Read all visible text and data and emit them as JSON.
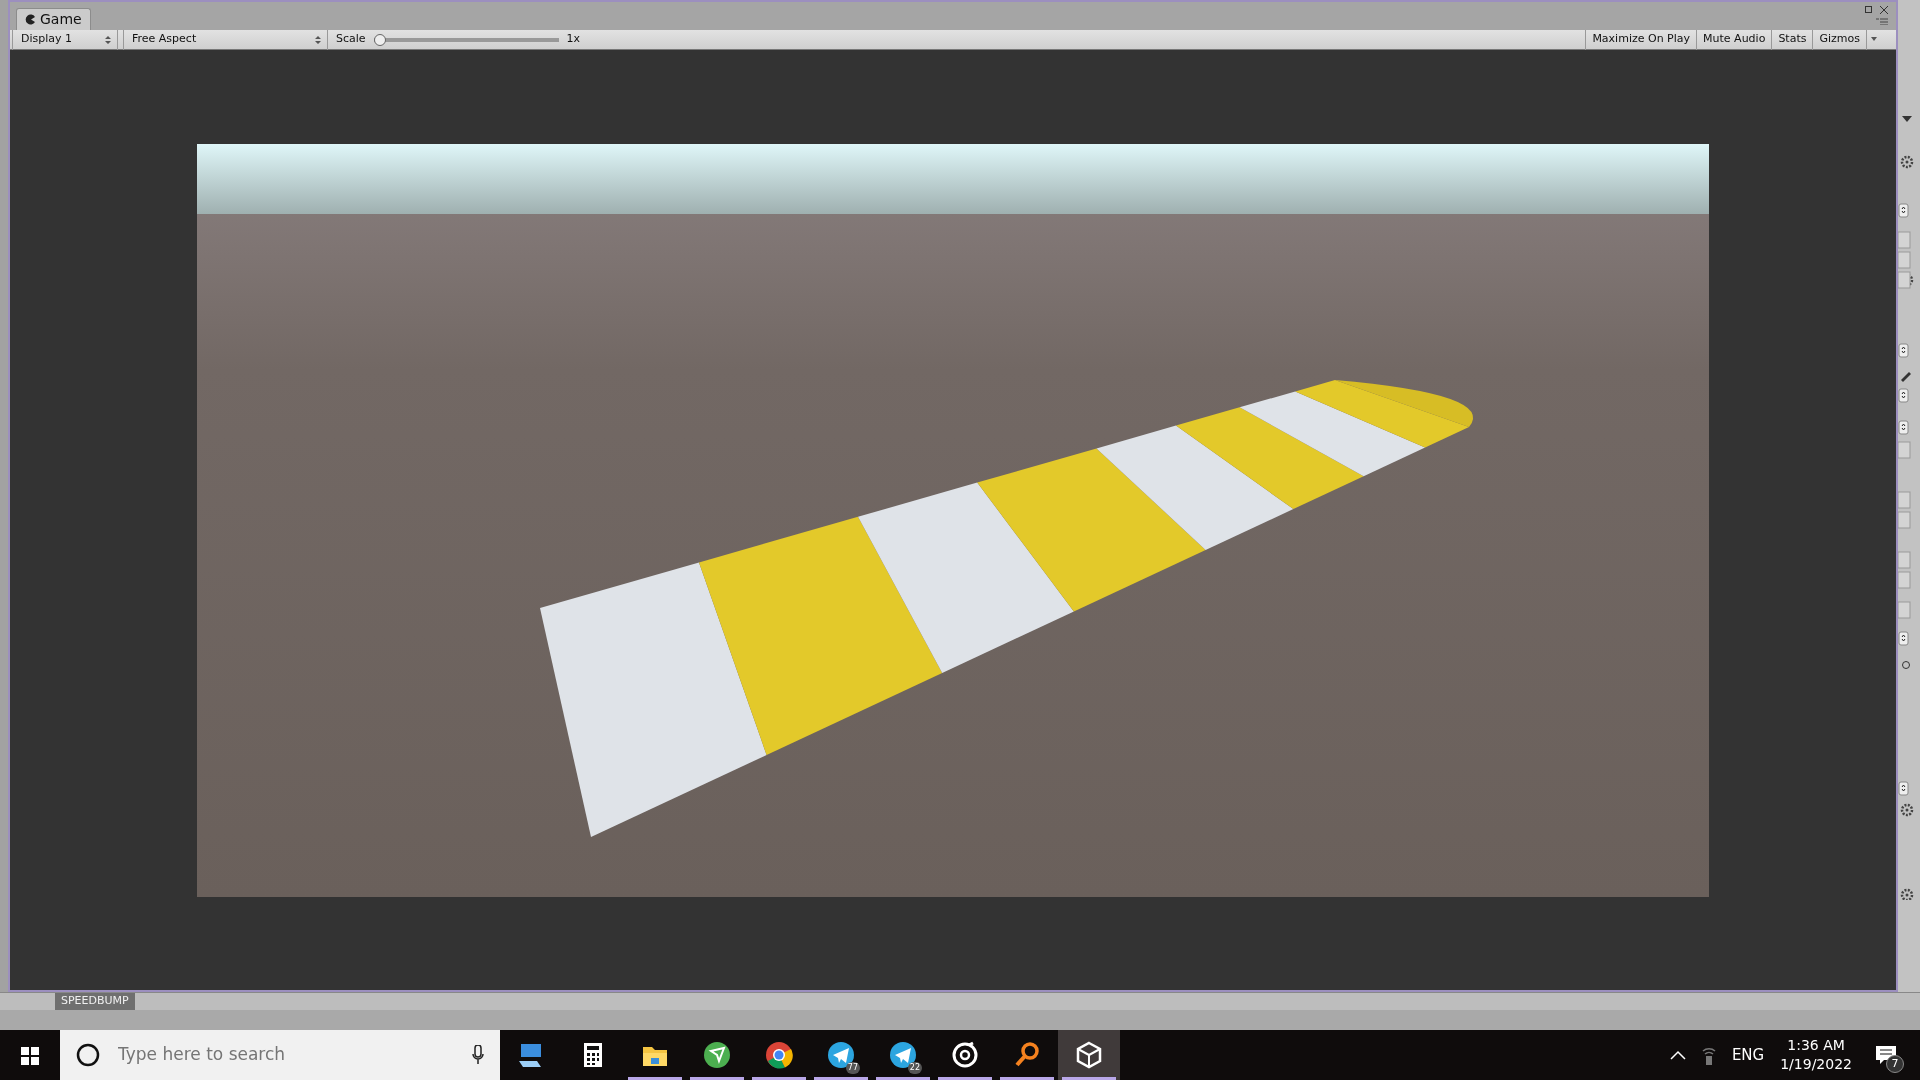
{
  "game_window": {
    "tab": {
      "label": "Game",
      "selected": true
    },
    "toolbar": {
      "display": "Display 1",
      "aspect": "Free Aspect",
      "scale_label": "Scale",
      "scale": {
        "level": 0
      },
      "scale_value": "1x",
      "buttons": [
        {
          "label": "Maximize On Play",
          "on": false
        },
        {
          "label": "Mute Audio",
          "on": false
        },
        {
          "label": "Stats",
          "on": false
        },
        {
          "label": "Gizmos",
          "on": false
        }
      ]
    }
  },
  "project_bar": {
    "label": "SPEEDBUMP"
  },
  "taskbar": {
    "search": {
      "placeholder": "Type here to search"
    },
    "apps": [
      {
        "kind": "computer",
        "running": false,
        "active": false
      },
      {
        "kind": "calculator",
        "running": false,
        "active": false
      },
      {
        "kind": "folder",
        "running": true,
        "active": false
      },
      {
        "kind": "plane-green",
        "running": true,
        "active": false
      },
      {
        "kind": "browser",
        "running": true,
        "active": false
      },
      {
        "kind": "plane-blue",
        "running": true,
        "active": false,
        "badge": "77"
      },
      {
        "kind": "plane-blue",
        "running": true,
        "active": false,
        "badge": "22"
      },
      {
        "kind": "ring",
        "running": true,
        "active": false
      },
      {
        "kind": "magnifier",
        "running": true,
        "active": false
      },
      {
        "kind": "cube",
        "running": true,
        "active": true
      }
    ],
    "tray": {
      "language": "ENG",
      "time": "1:36 AM",
      "date": "1/19/2022",
      "notifications": "7"
    }
  }
}
